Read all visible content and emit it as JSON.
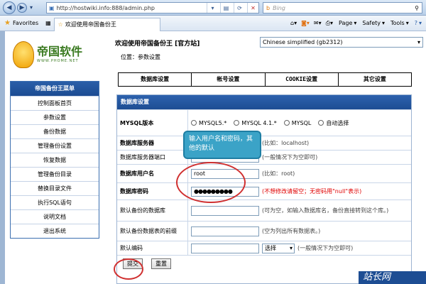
{
  "browser": {
    "back_icon": "back-arrow-icon",
    "forward_icon": "forward-arrow-icon",
    "url": "http://hostwiki.info:888/admin.php",
    "search_placeholder": "Bing",
    "favorites_label": "Favorites",
    "tab_title": "欢迎使用帝国备份王",
    "commands": {
      "page": "Page",
      "safety": "Safety",
      "tools": "Tools",
      "help": "?"
    }
  },
  "header": {
    "logo_text": "帝国软件",
    "logo_sub": "WWW.PHOME.NET",
    "welcome": "欢迎使用帝国备份王 [官方站]",
    "language": "Chinese simplified (gb2312)",
    "position": "位置：参数设置"
  },
  "sidebar": {
    "title": "帝国备份王菜单",
    "items": [
      {
        "label": "控制面板首页"
      },
      {
        "label": "参数设置"
      },
      {
        "label": "备份数据"
      },
      {
        "label": "管理备份设置"
      },
      {
        "label": "恢复数据"
      },
      {
        "label": "管理备份目录"
      },
      {
        "label": "替换目录文件"
      },
      {
        "label": "执行SQL语句"
      },
      {
        "label": "说明文档"
      },
      {
        "label": "退出系统"
      }
    ]
  },
  "top_menu": [
    "数据库设置",
    "帐号设置",
    "COOKIE设置",
    "其它设置"
  ],
  "form": {
    "title": "数据库设置",
    "mysql_version": {
      "label": "MYSQL版本",
      "options": [
        "MYSQL5.*",
        "MYSQL 4.1.*",
        "MYSQL",
        "自动选择"
      ]
    },
    "db_server": {
      "label": "数据库服务器",
      "hint": "(比如：localhost)"
    },
    "db_port": {
      "label": "数据库服务器端口",
      "hint": "(一般情况下为空即可)"
    },
    "db_user": {
      "label": "数据库用户名",
      "value": "root",
      "hint": "(比如：root)"
    },
    "db_password": {
      "label": "数据库密码",
      "value": "●●●●●●●●●",
      "hint": "(不想修改请留空；无密码用\"null\"表示)"
    },
    "default_db": {
      "label": "默认备份的数据库",
      "hint": "(可为空，如输入数据库名，备份直接转到这个库。)"
    },
    "default_table_prefix": {
      "label": "默认备份数据表的前缀",
      "hint": "(空为列出所有数据表。)"
    },
    "default_charset": {
      "label": "默认编码",
      "select": "选择",
      "hint": "(一般情况下为空即可)"
    },
    "submit_label": "提交",
    "reset_label": "重置"
  },
  "callout_text": "输入用户名和密码，其他的默认",
  "watermark_text": "站长网"
}
